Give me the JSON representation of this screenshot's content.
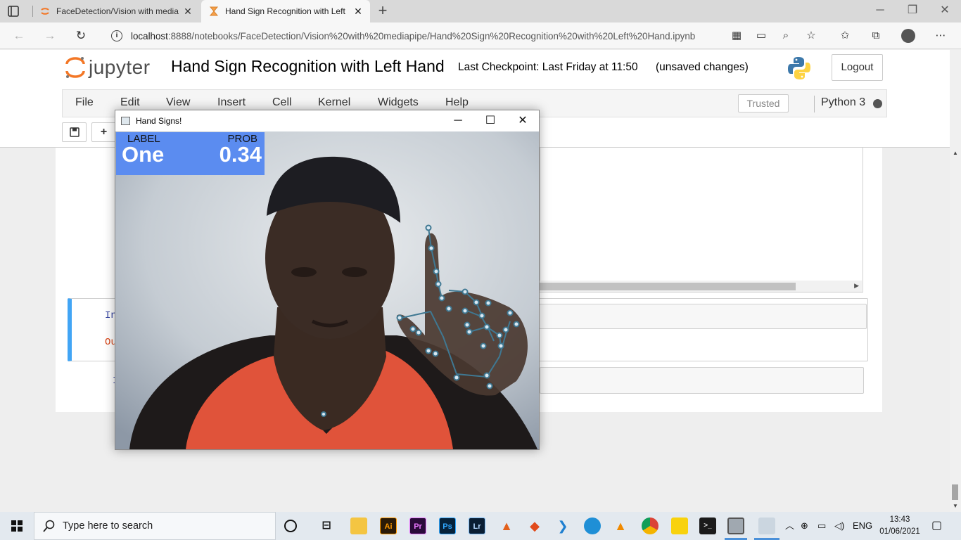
{
  "browser": {
    "tabs": [
      {
        "title": "FaceDetection/Vision with media",
        "active": false
      },
      {
        "title": "Hand Sign Recognition with Left",
        "active": true
      }
    ],
    "url_host": "localhost",
    "url_rest": ":8888/notebooks/FaceDetection/Vision%20with%20mediapipe/Hand%20Sign%20Recognition%20with%20Left%20Hand.ipynb"
  },
  "jupyter": {
    "logo_text": "jupyter",
    "notebook_title": "Hand Sign Recognition with Left Hand",
    "checkpoint": "Last Checkpoint: Last Friday at 11:50",
    "unsaved": "(unsaved changes)",
    "logout": "Logout",
    "menu": [
      "File",
      "Edit",
      "View",
      "Insert",
      "Cell",
      "Kernel",
      "Widgets",
      "Help"
    ],
    "trusted": "Trusted",
    "kernel": "Python 3",
    "cells": [
      {
        "in_prompt": "In",
        "out_prompt": "Ou"
      },
      {
        "in_prompt": "I"
      }
    ]
  },
  "cv_window": {
    "title": "Hand Signs!",
    "label_header": "LABEL",
    "prob_header": "PROB",
    "label_value": "One",
    "prob_value": "0.34"
  },
  "taskbar": {
    "search_placeholder": "Type here to search",
    "language": "ENG",
    "time": "13:43",
    "date": "01/06/2021"
  },
  "colors": {
    "accent_blue": "#42a5f5",
    "label_box": "#5b8cf0",
    "jupyter_orange": "#f37726",
    "shirt_red": "#e0533a"
  }
}
